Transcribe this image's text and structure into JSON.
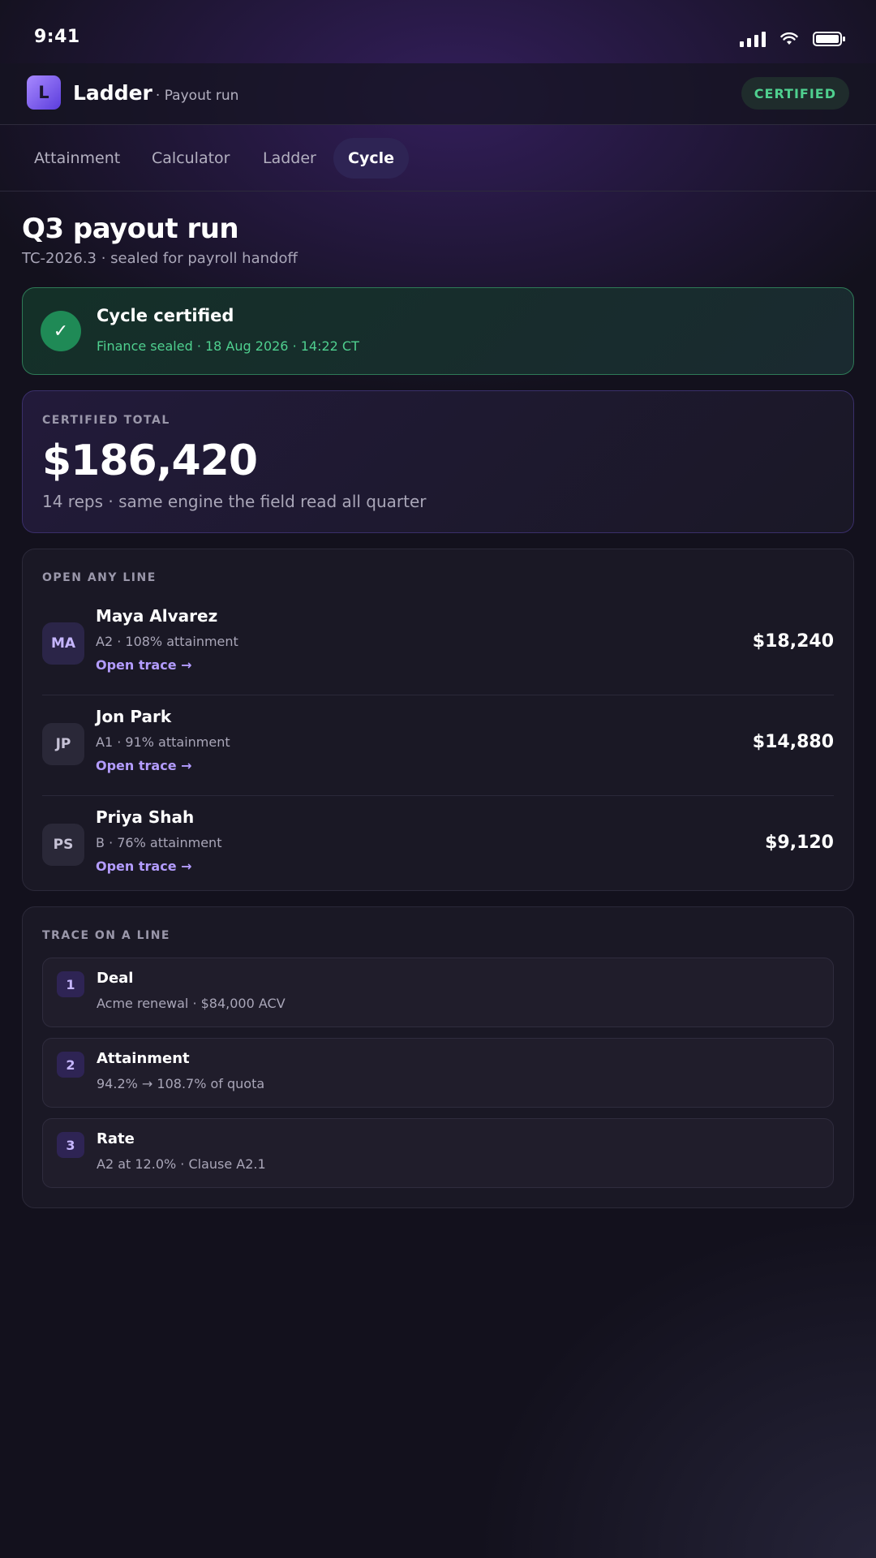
{
  "status_bar": {
    "time": "9:41"
  },
  "header": {
    "logo_letter": "L",
    "app_name": "Ladder",
    "app_sub": "· Payout run",
    "status_badge": "CERTIFIED"
  },
  "tabs": [
    {
      "label": "Attainment",
      "active": false
    },
    {
      "label": "Calculator",
      "active": false
    },
    {
      "label": "Ladder",
      "active": false
    },
    {
      "label": "Cycle",
      "active": true
    }
  ],
  "page": {
    "title": "Q3 payout run",
    "subtitle": "TC-2026.3 · sealed for payroll handoff"
  },
  "certified_banner": {
    "icon": "check-icon",
    "title": "Cycle certified",
    "subtitle": "Finance sealed · 18 Aug 2026 · 14:22 CT"
  },
  "total": {
    "label": "CERTIFIED TOTAL",
    "value": "$186,420",
    "subtitle": "14 reps · same engine the field read all quarter"
  },
  "lines": {
    "label": "OPEN ANY LINE",
    "link_label": "Open trace →",
    "reps": [
      {
        "initials": "MA",
        "name": "Maya Alvarez",
        "meta": "A2 · 108% attainment",
        "amount": "$18,240"
      },
      {
        "initials": "JP",
        "name": "Jon Park",
        "meta": "A1 · 91% attainment",
        "amount": "$14,880"
      },
      {
        "initials": "PS",
        "name": "Priya Shah",
        "meta": "B · 76% attainment",
        "amount": "$9,120"
      }
    ]
  },
  "trace": {
    "label": "TRACE ON A LINE",
    "steps": [
      {
        "num": "1",
        "title": "Deal",
        "detail": "Acme renewal · $84,000 ACV"
      },
      {
        "num": "2",
        "title": "Attainment",
        "detail": "94.2% → 108.7% of quota"
      },
      {
        "num": "3",
        "title": "Rate",
        "detail": "A2 at 12.0% · Clause A2.1"
      }
    ]
  },
  "colors": {
    "accent": "#b39cff",
    "success": "#4fd08f",
    "background": "#13111d"
  }
}
